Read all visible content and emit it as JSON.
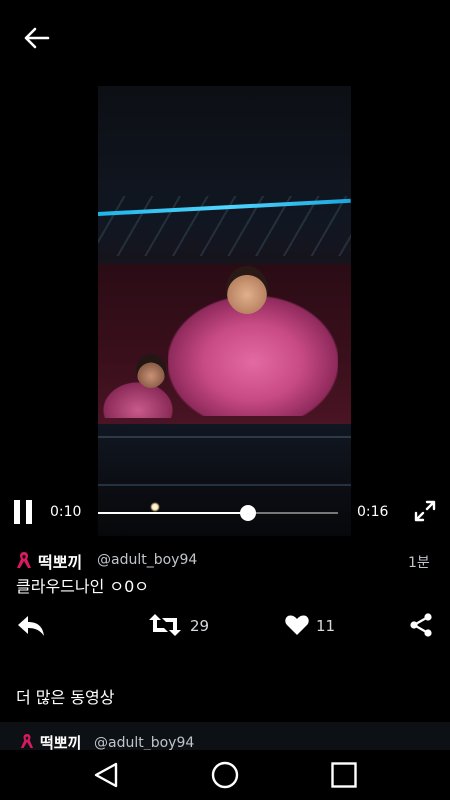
{
  "icons": {
    "back": "arrow-left-icon",
    "pause": "pause-icon",
    "fullscreen": "fullscreen-icon",
    "ribbon": "ribbon-icon",
    "reply": "reply-icon",
    "retweet": "retweet-icon",
    "like": "heart-icon",
    "share": "share-icon",
    "nav_back": "triangle-back-icon",
    "nav_home": "circle-home-icon",
    "nav_recent": "square-recent-icon"
  },
  "player": {
    "current_time": "0:10",
    "total_time": "0:16",
    "progress": 0.625
  },
  "tweet": {
    "author_name": "떡뽀끼",
    "author_handle": "@adult_boy94",
    "age": "1분",
    "text": "클라우드나인 ㅇ0ㅇ",
    "retweets": "29",
    "likes": "11"
  },
  "more": {
    "title": "더 많은 동영상",
    "next_author_name": "떡뽀끼",
    "next_author_handle": "@adult_boy94"
  },
  "colors": {
    "ribbon": "#d81b60",
    "background": "#000000"
  }
}
